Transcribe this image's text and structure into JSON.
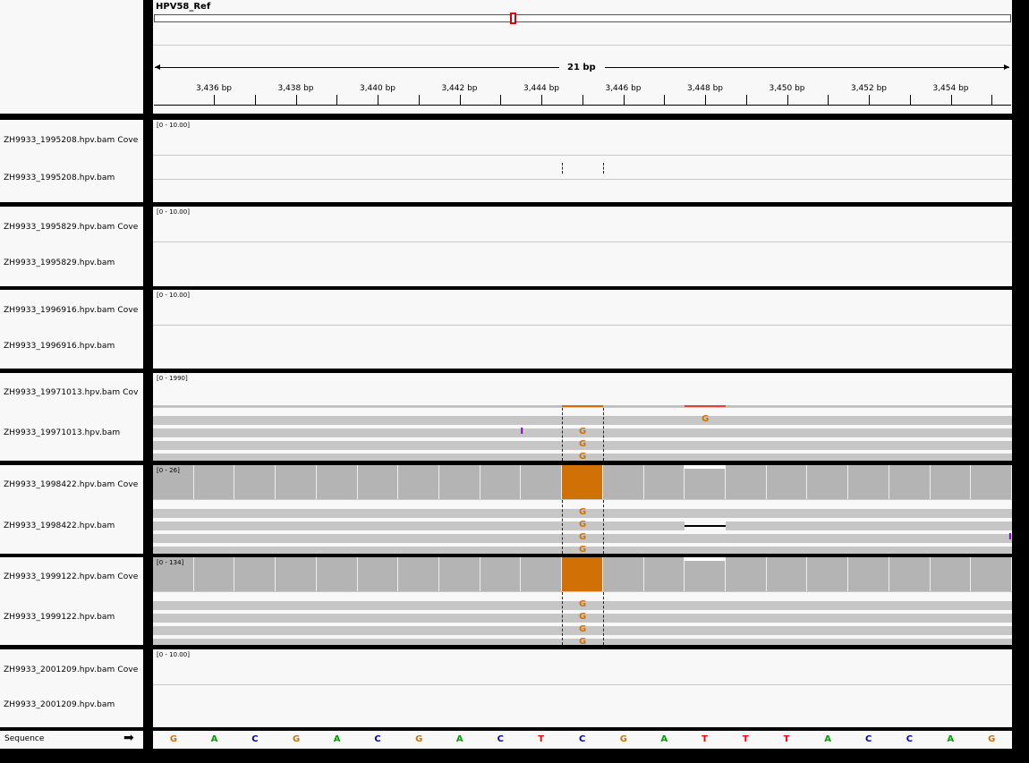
{
  "reference": {
    "chromosome": "HPV58_Ref",
    "span_label": "21 bp",
    "tick_labels": [
      "3,436 bp",
      "3,438 bp",
      "3,440 bp",
      "3,442 bp",
      "3,444 bp",
      "3,446 bp",
      "3,448 bp",
      "3,450 bp",
      "3,452 bp",
      "3,454 bp"
    ]
  },
  "tracks": [
    {
      "coverage_name": "ZH9933_1995208.hpv.bam Cove",
      "alignment_name": "ZH9933_1995208.hpv.bam",
      "scale": "[0 - 10.00]"
    },
    {
      "coverage_name": "ZH9933_1995829.hpv.bam Cove",
      "alignment_name": "ZH9933_1995829.hpv.bam",
      "scale": "[0 - 10.00]"
    },
    {
      "coverage_name": "ZH9933_1996916.hpv.bam Cove",
      "alignment_name": "ZH9933_1996916.hpv.bam",
      "scale": "[0 - 10.00]"
    },
    {
      "coverage_name": "ZH9933_19971013.hpv.bam Cov",
      "alignment_name": "ZH9933_19971013.hpv.bam",
      "scale": "[0 - 1990]"
    },
    {
      "coverage_name": "ZH9933_1998422.hpv.bam Cove",
      "alignment_name": "ZH9933_1998422.hpv.bam",
      "scale": "[0 - 26]"
    },
    {
      "coverage_name": "ZH9933_1999122.hpv.bam Cove",
      "alignment_name": "ZH9933_1999122.hpv.bam",
      "scale": "[0 - 134]"
    },
    {
      "coverage_name": "ZH9933_2001209.hpv.bam Cove",
      "alignment_name": "ZH9933_2001209.hpv.bam",
      "scale": "[0 - 10.00]"
    }
  ],
  "mismatch_base": "G",
  "insertion_marker": "I",
  "sequence": {
    "label": "Sequence",
    "arrow": "➡",
    "bases": [
      "G",
      "A",
      "C",
      "G",
      "A",
      "C",
      "G",
      "A",
      "C",
      "T",
      "C",
      "G",
      "A",
      "T",
      "T",
      "T",
      "A",
      "C",
      "C",
      "A",
      "G"
    ]
  },
  "colors": {
    "A": "#00a000",
    "C": "#0000c8",
    "G": "#d17105",
    "T": "#ff0000",
    "insertion": "#8000c0",
    "mismatch_fill": "#d17105"
  }
}
